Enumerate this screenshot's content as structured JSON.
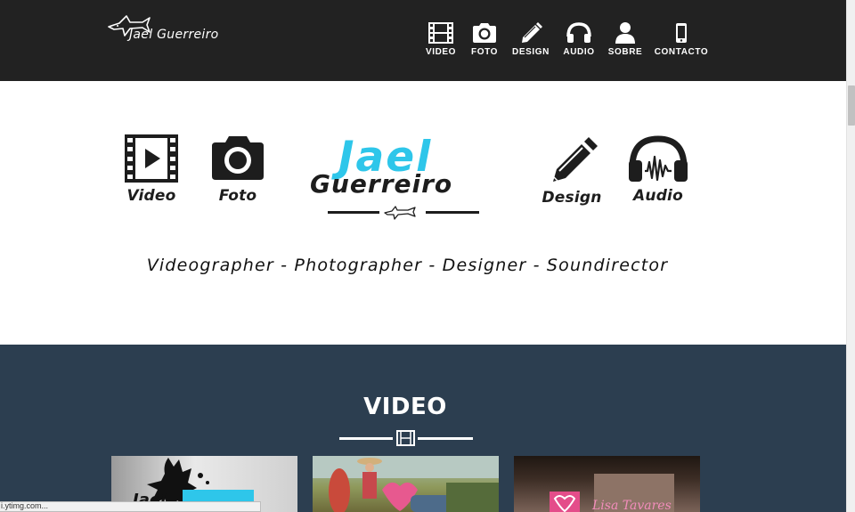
{
  "header": {
    "brand": "Jael Guerreiro",
    "nav": [
      {
        "label": "VIDEO",
        "icon": "film-icon"
      },
      {
        "label": "FOTO",
        "icon": "camera-icon"
      },
      {
        "label": "DESIGN",
        "icon": "pencil-icon"
      },
      {
        "label": "AUDIO",
        "icon": "headphones-icon"
      },
      {
        "label": "SOBRE",
        "icon": "user-icon"
      },
      {
        "label": "CONTACTO",
        "icon": "mobile-phone-icon"
      }
    ]
  },
  "hero": {
    "items": [
      {
        "label": "Video",
        "icon": "film-play-icon"
      },
      {
        "label": "Foto",
        "icon": "camera-icon"
      },
      {
        "label": "Design",
        "icon": "pencil-icon"
      },
      {
        "label": "Audio",
        "icon": "headphones-icon"
      }
    ],
    "logo": {
      "line1": "Jael",
      "line2": "Guerreiro",
      "emblem": "shark-icon"
    },
    "tagline": "Videographer - Photographer - Designer - Soundirector"
  },
  "video_section": {
    "title": "VIDEO",
    "divider_icon": "film-icon",
    "thumbnails": [
      {
        "caption": "Jael"
      },
      {
        "caption": ""
      },
      {
        "caption": "Lisa Tavares"
      }
    ]
  },
  "status_bar": {
    "text": "i.ytimg.com..."
  },
  "colors": {
    "navbar_bg": "#222222",
    "accent": "#2ec6ea",
    "section_bg": "#2c3e50",
    "text_dark": "#1d1d1d"
  }
}
